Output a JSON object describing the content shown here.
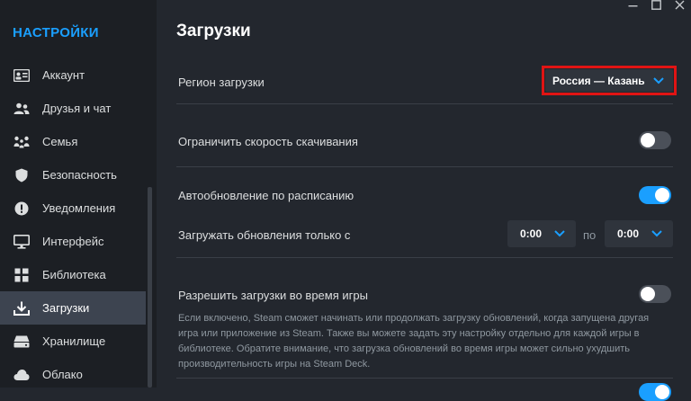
{
  "sidebar": {
    "title": "НАСТРОЙКИ",
    "items": [
      {
        "label": "Аккаунт",
        "icon": "id-card-icon"
      },
      {
        "label": "Друзья и чат",
        "icon": "friends-icon"
      },
      {
        "label": "Семья",
        "icon": "family-icon"
      },
      {
        "label": "Безопасность",
        "icon": "shield-icon"
      },
      {
        "label": "Уведомления",
        "icon": "alert-icon"
      },
      {
        "label": "Интерфейс",
        "icon": "monitor-icon"
      },
      {
        "label": "Библиотека",
        "icon": "grid-icon"
      },
      {
        "label": "Загрузки",
        "icon": "download-icon",
        "active": true
      },
      {
        "label": "Хранилище",
        "icon": "storage-icon"
      },
      {
        "label": "Облако",
        "icon": "cloud-icon"
      }
    ]
  },
  "main": {
    "title": "Загрузки",
    "region": {
      "label": "Регион загрузки",
      "value": "Россия — Казань"
    },
    "limit_speed": {
      "label": "Ограничить скорость скачивания",
      "enabled": false
    },
    "auto_update": {
      "label": "Автообновление по расписанию",
      "enabled": true
    },
    "update_window": {
      "label": "Загружать обновления только с",
      "from": "0:00",
      "to_label": "по",
      "to": "0:00"
    },
    "allow_during_game": {
      "label": "Разрешить загрузки во время игры",
      "enabled": false,
      "description": "Если включено, Steam сможет начинать или продолжать загрузку обновлений, когда запущена другая игра или приложение из Steam. Также вы можете задать эту настройку отдельно для каждой игры в библиотеке. Обратите внимание, что загрузка обновлений во время игры может сильно ухудшить производительность игры на Steam Deck."
    }
  },
  "colors": {
    "accent": "#1a9fff",
    "highlight_border": "#e01414",
    "background": "#23272e",
    "sidebar_bg": "#1c1f24"
  }
}
